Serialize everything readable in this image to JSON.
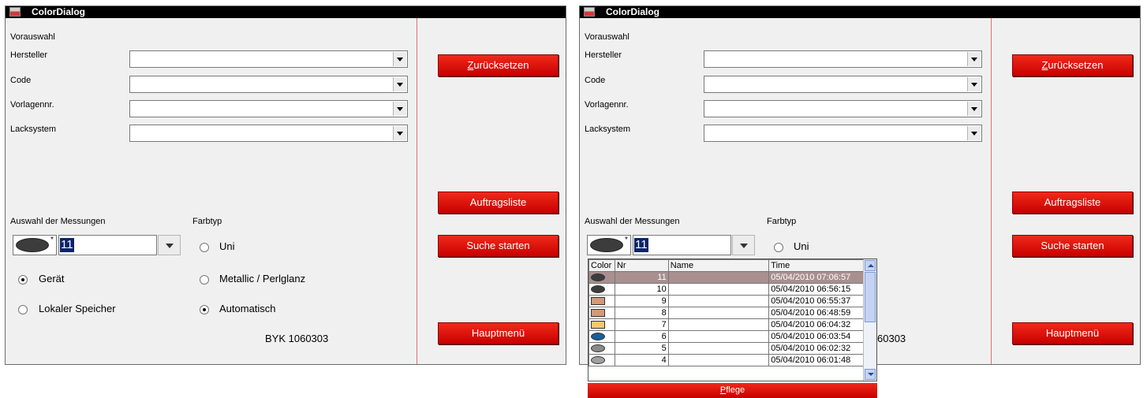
{
  "window": {
    "title": "ColorDialog"
  },
  "form": {
    "vorauswahl": "Vorauswahl",
    "fields": [
      {
        "label": "Hersteller",
        "value": ""
      },
      {
        "label": "Code",
        "value": ""
      },
      {
        "label": "Vorlagennr.",
        "value": ""
      },
      {
        "label": "Lacksystem",
        "value": ""
      }
    ],
    "auswahl_label": "Auswahl der Messungen",
    "farbtyp_label": "Farbtyp",
    "measurement_value": "11",
    "source_options": [
      {
        "label": "Gerät",
        "selected": true
      },
      {
        "label": "Lokaler Speicher",
        "selected": false
      }
    ],
    "farbtyp_options": [
      {
        "label": "Uni",
        "selected": false
      },
      {
        "label": "Metallic / Perlglanz",
        "selected": false
      },
      {
        "label": "Automatisch",
        "selected": true
      }
    ],
    "device": "BYK 1060303"
  },
  "buttons": {
    "zuruecksetzen_prefix": "Z",
    "zuruecksetzen_rest": "urücksetzen",
    "auftragsliste": "Auftragsliste",
    "suche_starten": "Suche starten",
    "hauptmenue": "Hauptmenü"
  },
  "dropdown": {
    "headers": {
      "color": "Color",
      "nr": "Nr",
      "name": "Name",
      "time": "Time"
    },
    "rows": [
      {
        "nr": "11",
        "name": "",
        "time": "05/04/2010 07:06:57",
        "color": "#3c3c3c",
        "shape": "oval",
        "highlight": true
      },
      {
        "nr": "10",
        "name": "",
        "time": "05/04/2010 06:56:15",
        "color": "#3c3c3c",
        "shape": "oval",
        "highlight": false
      },
      {
        "nr": "9",
        "name": "",
        "time": "05/04/2010 06:55:37",
        "color": "#d39a78",
        "shape": "rect",
        "highlight": false
      },
      {
        "nr": "8",
        "name": "",
        "time": "05/04/2010 06:48:59",
        "color": "#d39a78",
        "shape": "rect",
        "highlight": false
      },
      {
        "nr": "7",
        "name": "",
        "time": "05/04/2010 06:04:32",
        "color": "#f7c86a",
        "shape": "rect",
        "highlight": false
      },
      {
        "nr": "6",
        "name": "",
        "time": "05/04/2010 06:03:54",
        "color": "#1a5d9a",
        "shape": "oval",
        "highlight": false
      },
      {
        "nr": "5",
        "name": "",
        "time": "05/04/2010 06:02:32",
        "color": "#8a8a8a",
        "shape": "oval",
        "highlight": false
      },
      {
        "nr": "4",
        "name": "",
        "time": "05/04/2010 06:01:48",
        "color": "#a0a0a0",
        "shape": "oval",
        "highlight": false
      }
    ],
    "pflege_prefix": "P",
    "pflege_rest": "flege",
    "partial_device": "60303"
  }
}
